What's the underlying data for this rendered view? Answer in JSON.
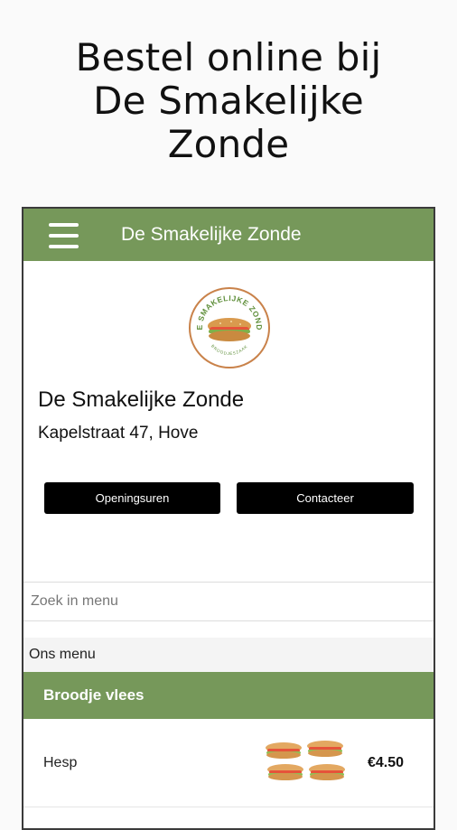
{
  "promo": {
    "heading_line1": "Bestel online bij",
    "heading_line2": "De Smakelijke",
    "heading_line3": "Zonde"
  },
  "app_bar": {
    "menu_icon": "hamburger-menu-icon",
    "title": "De Smakelijke Zonde",
    "color": "#76985a"
  },
  "shop": {
    "logo_text_top": "DE SMAKELIJKE ZONDE",
    "logo_text_bottom": "BROODJESZAAK",
    "name": "De Smakelijke Zonde",
    "address": "Kapelstraat 47, Hove"
  },
  "buttons": {
    "hours_label": "Openingsuren",
    "contact_label": "Contacteer"
  },
  "search": {
    "placeholder": "Zoek in menu",
    "value": ""
  },
  "menu": {
    "caption": "Ons menu",
    "categories": [
      {
        "label": "Broodje vlees",
        "items": [
          {
            "name": "Hesp",
            "price": "€4.50",
            "image": "sandwich-image"
          }
        ]
      }
    ]
  }
}
